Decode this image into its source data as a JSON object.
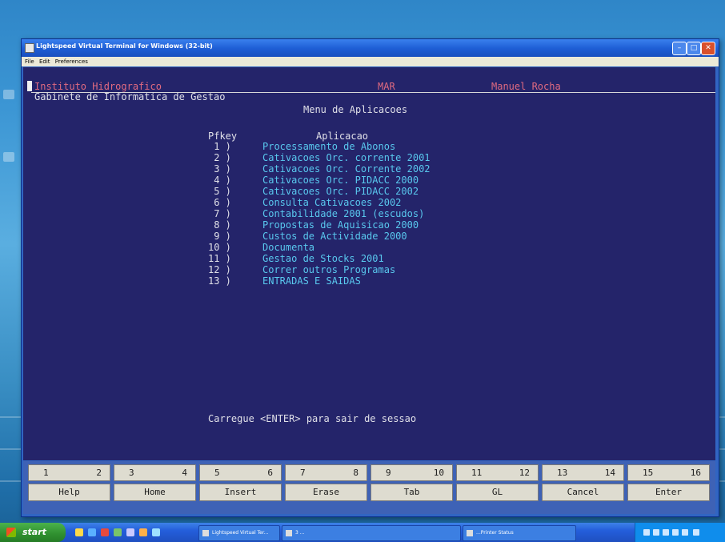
{
  "window": {
    "title": "Lightspeed Virtual Terminal for Windows (32-bit)",
    "menu": [
      "File",
      "Edit",
      "Preferences"
    ],
    "controls": [
      "minimize",
      "maximize",
      "close"
    ]
  },
  "terminal": {
    "header_left": "Instituto Hidrografico",
    "header_mid": "MAR",
    "header_right": "Manuel Rocha",
    "subtitle": "Gabinete de Informatica de Gestao",
    "menu_title": "Menu de Aplicacoes",
    "col_pfkey": "Pfkey",
    "col_app": "Aplicacao",
    "items": [
      {
        "key": " 1 )",
        "label": "Processamento de Abonos"
      },
      {
        "key": " 2 )",
        "label": "Cativacoes Orc. corrente 2001"
      },
      {
        "key": " 3 )",
        "label": "Cativacoes Orc. Corrente 2002"
      },
      {
        "key": " 4 )",
        "label": "Cativacoes Orc. PIDACC 2000"
      },
      {
        "key": " 5 )",
        "label": "Cativacoes Orc. PIDACC 2002"
      },
      {
        "key": " 6 )",
        "label": "Consulta Cativacoes 2002"
      },
      {
        "key": " 7 )",
        "label": "Contabilidade 2001 (escudos)"
      },
      {
        "key": " 8 )",
        "label": "Propostas de Aquisicao 2000"
      },
      {
        "key": " 9 )",
        "label": "Custos de Actividade 2000"
      },
      {
        "key": "10 )",
        "label": "Documenta"
      },
      {
        "key": "11 )",
        "label": "Gestao de Stocks 2001"
      },
      {
        "key": "12 )",
        "label": "Correr outros Programas"
      },
      {
        "key": "13 )",
        "label": "ENTRADAS E SAIDAS"
      }
    ],
    "footer": "Carregue <ENTER> para sair de sessao"
  },
  "fkeys": {
    "pairs": [
      [
        "1",
        "2"
      ],
      [
        "3",
        "4"
      ],
      [
        "5",
        "6"
      ],
      [
        "7",
        "8"
      ],
      [
        "9",
        "10"
      ],
      [
        "11",
        "12"
      ],
      [
        "13",
        "14"
      ],
      [
        "15",
        "16"
      ]
    ],
    "labels": [
      "Help",
      "Home",
      "Insert",
      "Erase",
      "Tab",
      "GL",
      "Cancel",
      "Enter"
    ]
  },
  "taskbar": {
    "start_label": "start",
    "tasks": [
      "Lightspeed Virtual Ter...",
      "3 ...",
      "...Printer Status"
    ]
  }
}
